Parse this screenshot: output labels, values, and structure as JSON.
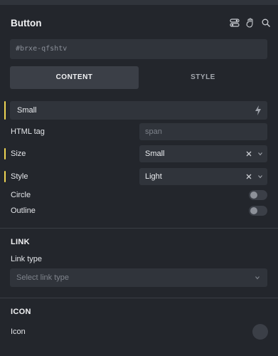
{
  "panel": {
    "title": "Button",
    "element_id": "#brxe-qfshtv",
    "header_icons": [
      "toggle-icon",
      "hand-icon",
      "search-icon"
    ]
  },
  "tabs": [
    {
      "label": "CONTENT",
      "active": true
    },
    {
      "label": "STYLE",
      "active": false
    }
  ],
  "preset": {
    "value": "Small",
    "icon": "bolt-icon"
  },
  "fields": {
    "html_tag": {
      "label": "HTML tag",
      "placeholder": "span"
    },
    "size": {
      "label": "Size",
      "value": "Small"
    },
    "style": {
      "label": "Style",
      "value": "Light"
    },
    "circle": {
      "label": "Circle",
      "on": false
    },
    "outline": {
      "label": "Outline",
      "on": false
    }
  },
  "link_section": {
    "title": "LINK",
    "link_type_label": "Link type",
    "link_type_placeholder": "Select link type"
  },
  "icon_section": {
    "title": "ICON",
    "icon_label": "Icon"
  },
  "colors": {
    "background": "#23262c",
    "field": "#30343b",
    "marker": "#f0d653"
  }
}
